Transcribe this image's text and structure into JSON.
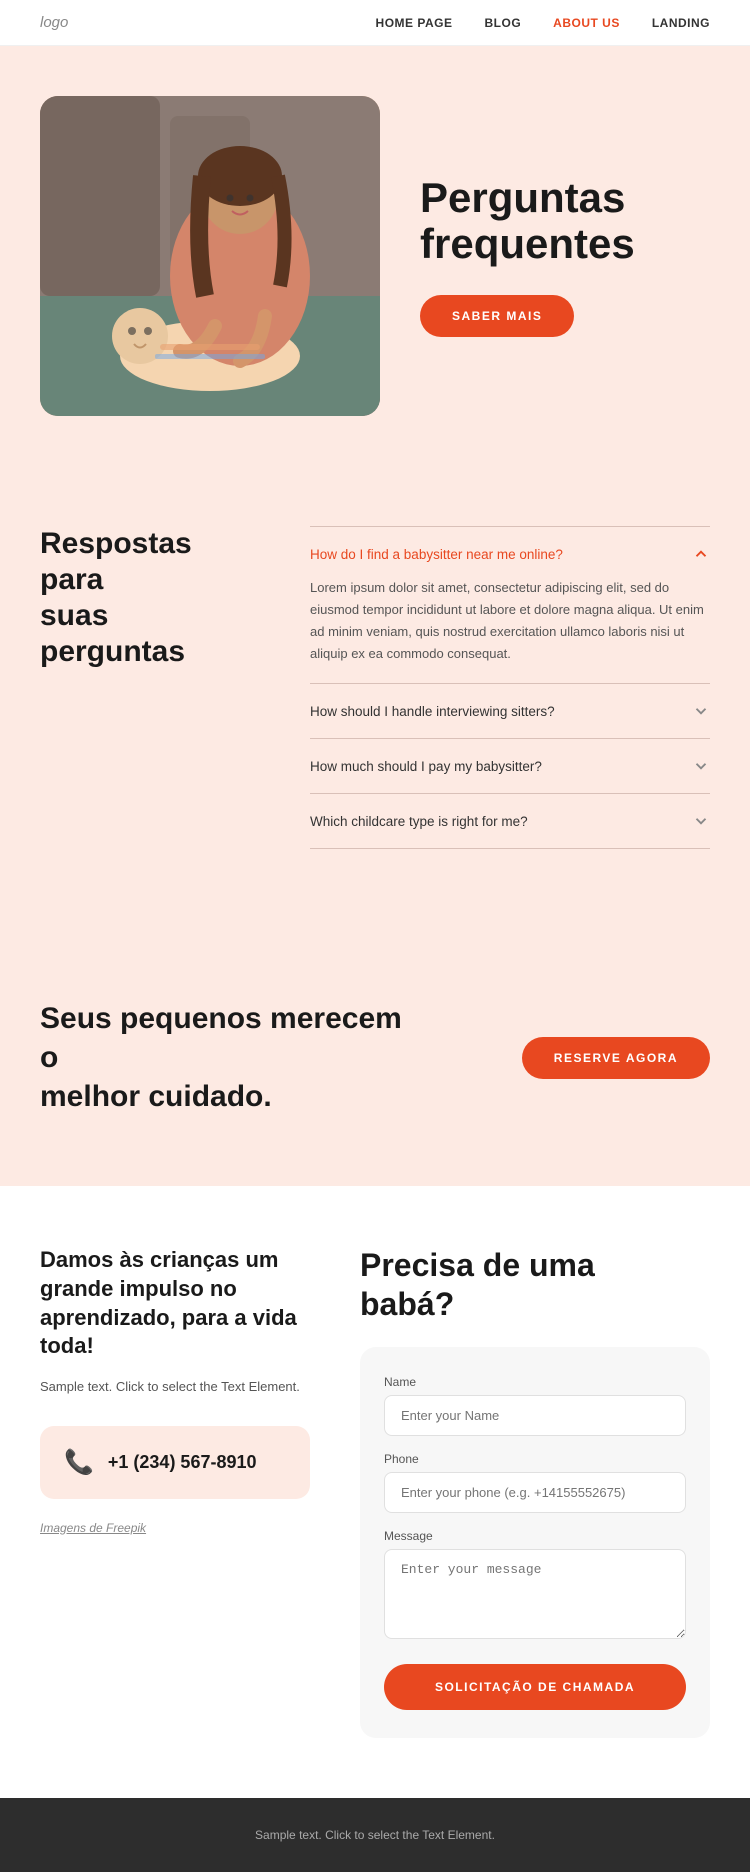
{
  "nav": {
    "logo": "logo",
    "links": [
      {
        "label": "HOME PAGE",
        "href": "#",
        "active": false
      },
      {
        "label": "BLOG",
        "href": "#",
        "active": false
      },
      {
        "label": "ABOUT US",
        "href": "#",
        "active": true
      },
      {
        "label": "LANDING",
        "href": "#",
        "active": false
      }
    ]
  },
  "hero": {
    "title_line1": "Perguntas",
    "title_line2": "frequentes",
    "button_label": "SABER MAIS"
  },
  "faq": {
    "section_title_line1": "Respostas para",
    "section_title_line2": "suas perguntas",
    "items": [
      {
        "question": "How do I find a babysitter near me online?",
        "active": true,
        "answer": "Lorem ipsum dolor sit amet, consectetur adipiscing elit, sed do eiusmod tempor incididunt ut labore et dolore magna aliqua. Ut enim ad minim veniam, quis nostrud exercitation ullamco laboris nisi ut aliquip ex ea commodo consequat."
      },
      {
        "question": "How should I handle interviewing sitters?",
        "active": false,
        "answer": ""
      },
      {
        "question": "How much should I pay my babysitter?",
        "active": false,
        "answer": ""
      },
      {
        "question": "Which childcare type is right for me?",
        "active": false,
        "answer": ""
      }
    ]
  },
  "cta": {
    "title_line1": "Seus pequenos merecem o",
    "title_line2": "melhor cuidado.",
    "button_label": "RESERVE AGORA"
  },
  "contact": {
    "left_title": "Damos às crianças um grande impulso no aprendizado, para a vida toda!",
    "left_text": "Sample text. Click to select the Text Element.",
    "phone": "+1 (234) 567-8910",
    "freepik_text": "Imagens de Freepik",
    "form_title_line1": "Precisa de uma",
    "form_title_line2": "babá?",
    "form": {
      "name_label": "Name",
      "name_placeholder": "Enter your Name",
      "phone_label": "Phone",
      "phone_placeholder": "Enter your phone (e.g. +14155552675)",
      "message_label": "Message",
      "message_placeholder": "Enter your message",
      "submit_label": "SOLICITAÇÃO DE CHAMADA"
    }
  },
  "footer": {
    "text": "Sample text. Click to select the Text Element."
  }
}
